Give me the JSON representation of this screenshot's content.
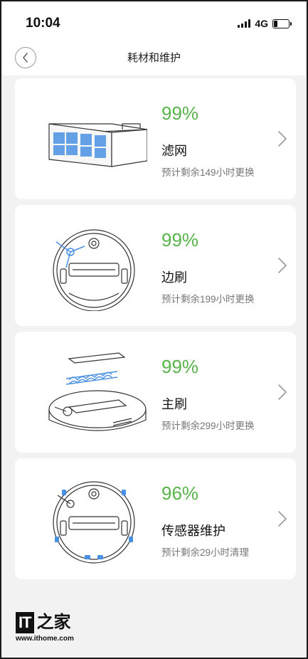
{
  "status_bar": {
    "time": "10:04",
    "network": "4G",
    "battery_level": 0.2
  },
  "nav": {
    "title": "耗材和维护",
    "back_icon": "chevron-left-icon"
  },
  "items": [
    {
      "percent": "99%",
      "name": "滤网",
      "remaining": "预计剩余149小时更换",
      "illustration": "filter-icon"
    },
    {
      "percent": "99%",
      "name": "边刷",
      "remaining": "预计剩余199小时更换",
      "illustration": "side-brush-icon"
    },
    {
      "percent": "99%",
      "name": "主刷",
      "remaining": "预计剩余299小时更换",
      "illustration": "main-brush-icon"
    },
    {
      "percent": "96%",
      "name": "传感器维护",
      "remaining": "预计剩余29小时清理",
      "illustration": "sensor-icon"
    }
  ],
  "colors": {
    "percent_green": "#57b34a",
    "background": "#f2f2f2"
  },
  "watermark": {
    "logo": "IT之家",
    "url": "www.ithome.com"
  }
}
